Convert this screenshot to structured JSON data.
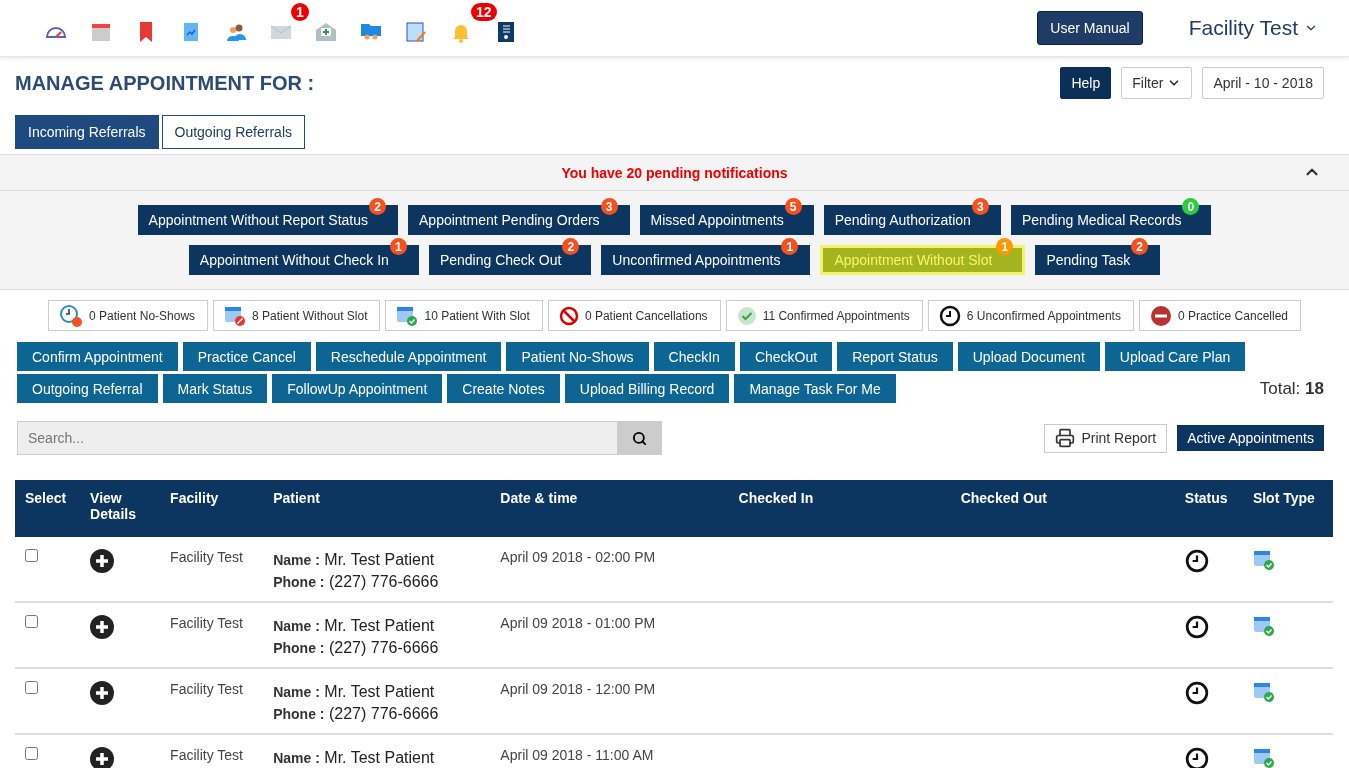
{
  "top_icons": [
    {
      "kind": "gauge"
    },
    {
      "kind": "calendar"
    },
    {
      "kind": "bookmark"
    },
    {
      "kind": "chart-doc"
    },
    {
      "kind": "people"
    },
    {
      "kind": "mail",
      "badge": "1"
    },
    {
      "kind": "mail-plus"
    },
    {
      "kind": "folder-people"
    },
    {
      "kind": "notepad"
    },
    {
      "kind": "bell",
      "badge": "12"
    },
    {
      "kind": "contact-list"
    }
  ],
  "user_manual": "User Manual",
  "facility_menu": "Facility Test",
  "title": "MANAGE APPOINTMENT FOR :",
  "header_buttons": {
    "help": "Help",
    "filter": "Filter",
    "date": "April - 10 - 2018"
  },
  "tabs": [
    {
      "label": "Incoming Referrals",
      "selected": true
    },
    {
      "label": "Outgoing Referrals",
      "selected": false
    }
  ],
  "notice": "You have 20 pending notifications",
  "notice_expanded": true,
  "notification_rows": [
    [
      {
        "label": "Appointment Without Report Status",
        "count": "2",
        "color": "#f4511e",
        "selected": false
      },
      {
        "label": "Appointment Pending Orders",
        "count": "3",
        "color": "#f4511e",
        "selected": false
      },
      {
        "label": "Missed Appointments",
        "count": "5",
        "color": "#f4511e",
        "selected": false
      },
      {
        "label": "Pending Authorization",
        "count": "3",
        "color": "#f4511e",
        "selected": false
      },
      {
        "label": "Pending Medical Records",
        "count": "0",
        "color": "#2ecc40",
        "selected": false
      }
    ],
    [
      {
        "label": "Appointment Without Check In",
        "count": "1",
        "color": "#f4511e",
        "selected": false
      },
      {
        "label": "Pending Check Out",
        "count": "2",
        "color": "#f4511e",
        "selected": false
      },
      {
        "label": "Unconfirmed Appointments",
        "count": "1",
        "color": "#f4511e",
        "selected": false
      },
      {
        "label": "Appointment Without Slot",
        "count": "1",
        "color": "#ff9800",
        "selected": true
      },
      {
        "label": "Pending Task",
        "count": "2",
        "color": "#f4511e",
        "selected": false
      }
    ]
  ],
  "stats": [
    {
      "kind": "no-show",
      "label": "0 Patient No-Shows"
    },
    {
      "kind": "without-slot",
      "label": "8 Patient Without Slot"
    },
    {
      "kind": "with-slot",
      "label": "10 Patient With Slot"
    },
    {
      "kind": "cancel",
      "label": "0 Patient Cancellations"
    },
    {
      "kind": "confirmed",
      "label": "11 Confirmed Appointments"
    },
    {
      "kind": "unconfirmed",
      "label": "6 Unconfirmed Appointments"
    },
    {
      "kind": "practice-cancel",
      "label": "0 Practice Cancelled"
    }
  ],
  "action_rows": [
    [
      "Confirm Appointment",
      "Practice Cancel",
      "Reschedule Appointment",
      "Patient No-Shows",
      "CheckIn",
      "CheckOut",
      "Report Status",
      "Upload Document",
      "Upload Care Plan"
    ],
    [
      "Outgoing Referral",
      "Mark Status",
      "FollowUp Appointment",
      "Create Notes",
      "Upload Billing Record",
      "Manage Task For Me"
    ]
  ],
  "total": {
    "label": "Total:",
    "value": "18"
  },
  "search": {
    "placeholder": "Search..."
  },
  "print_report": "Print Report",
  "active_appointments": "Active Appointments",
  "table": {
    "columns": [
      "Select",
      "View Details",
      "Facility",
      "Patient",
      "Date & time",
      "Checked In",
      "Checked Out",
      "Status",
      "Slot Type"
    ],
    "rows": [
      {
        "checked": false,
        "facility": "Facility Test",
        "name_label": "Name :",
        "name": "Mr. Test Patient",
        "phone_label": "Phone :",
        "phone": "(227) 776-6666",
        "datetime": "April 09 2018 - 02:00 PM"
      },
      {
        "checked": false,
        "facility": "Facility Test",
        "name_label": "Name :",
        "name": "Mr. Test Patient",
        "phone_label": "Phone :",
        "phone": "(227) 776-6666",
        "datetime": "April 09 2018 - 01:00 PM"
      },
      {
        "checked": false,
        "facility": "Facility Test",
        "name_label": "Name :",
        "name": "Mr. Test Patient",
        "phone_label": "Phone :",
        "phone": "(227) 776-6666",
        "datetime": "April 09 2018 - 12:00 PM"
      },
      {
        "checked": false,
        "facility": "Facility Test",
        "name_label": "Name :",
        "name": "Mr. Test Patient",
        "datetime": "April 09 2018 - 11:00 AM"
      }
    ]
  }
}
